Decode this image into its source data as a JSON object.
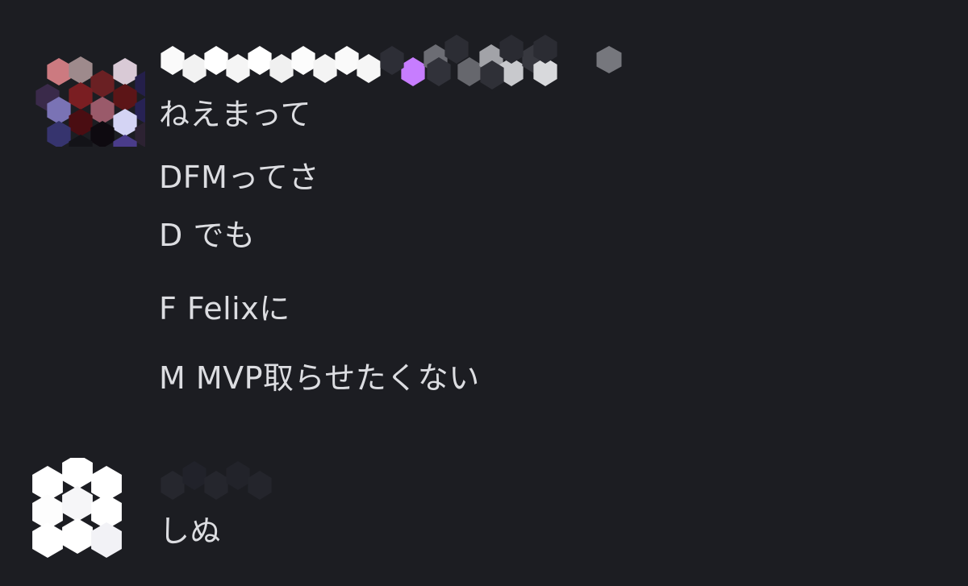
{
  "messages": [
    {
      "author_name": "",
      "timestamp": "",
      "lines": [
        "ねえまって",
        "DFMってさ",
        "D でも",
        "F Felixに",
        "M MVP取らせたくない"
      ],
      "role_color": "#c77dff"
    },
    {
      "author_name": "",
      "timestamp": "",
      "lines": [
        "しぬ"
      ]
    }
  ]
}
